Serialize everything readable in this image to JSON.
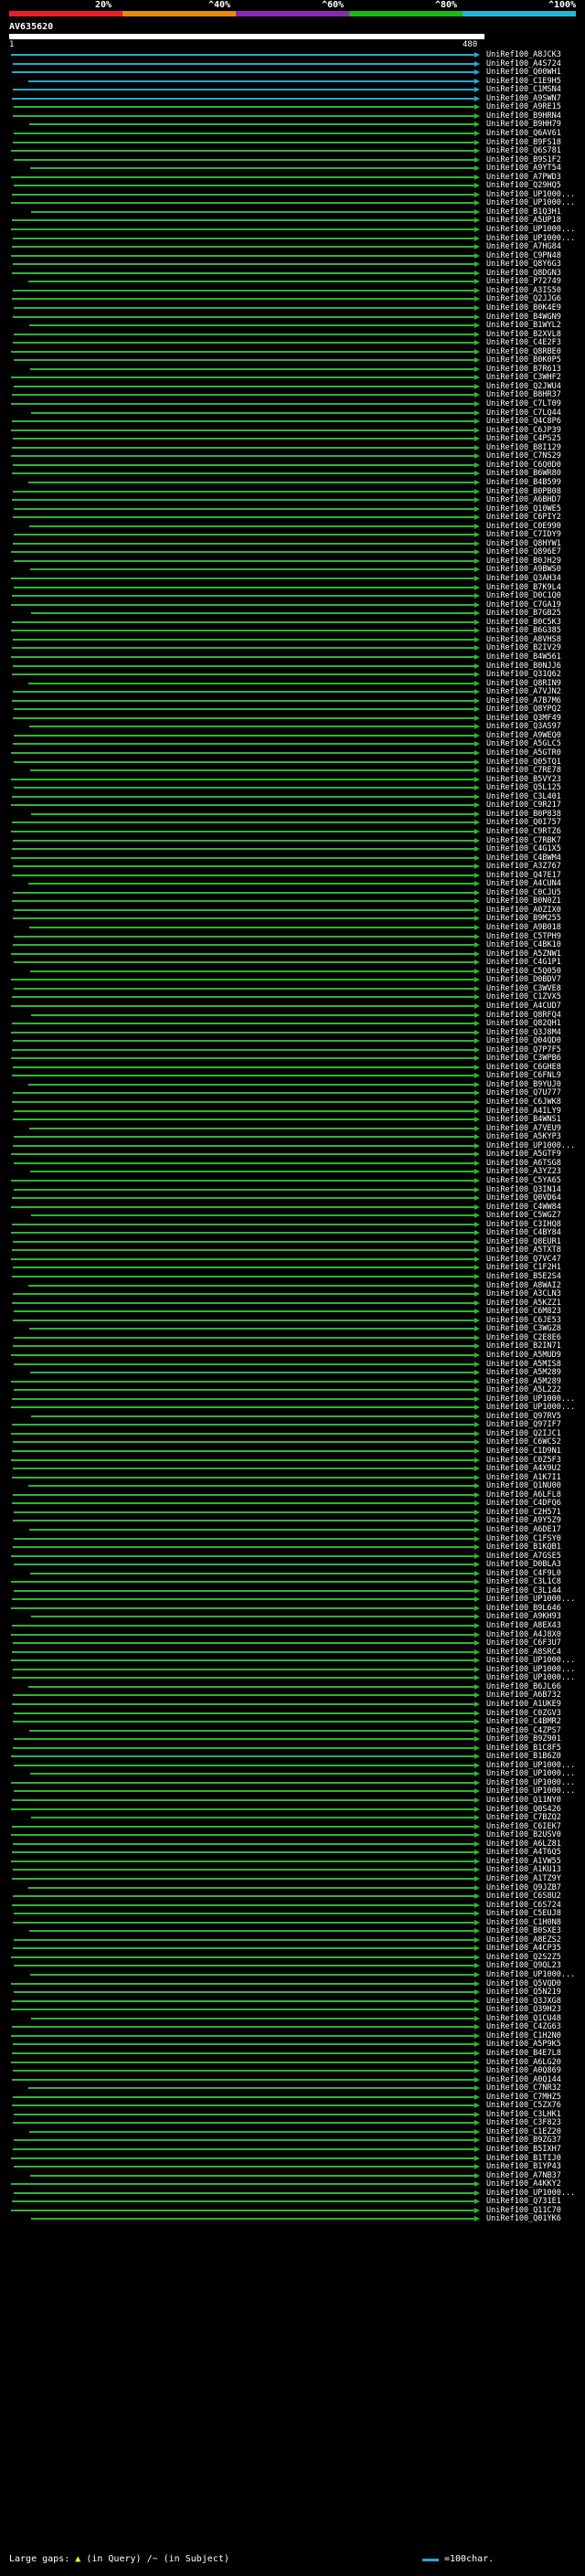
{
  "legend": {
    "labels": [
      "20%",
      "^40%",
      "^60%",
      "^80%",
      "^100%"
    ],
    "colors": [
      "#e8202a",
      "#e88a10",
      "#8a28b0",
      "#18b818",
      "#22b8d8"
    ]
  },
  "query": {
    "name": "AV635620",
    "start": "1",
    "end": "480"
  },
  "hits": [
    "UniRef100_A8JCK3",
    "UniRef100_A4S724",
    "UniRef100_Q00WH1",
    "UniRef100_C1E9H5",
    "UniRef100_C1MSN4",
    "UniRef100_A9SWN7",
    "UniRef100_A9RE15",
    "UniRef100_B9HRN4",
    "UniRef100_B9HH79",
    "UniRef100_Q6AV61",
    "UniRef100_B9FS18",
    "UniRef100_Q6S781",
    "UniRef100_B9S1F2",
    "UniRef100_A9YT54",
    "UniRef100_A7PWD3",
    "UniRef100_Q29HQ5",
    "UniRef100_UP1000...",
    "UniRef100_UP1000...",
    "UniRef100_B1Q3H1",
    "UniRef100_A5UP18",
    "UniRef100_UP1000...",
    "UniRef100_UP1000...",
    "UniRef100_A7HG84",
    "UniRef100_C9PN48",
    "UniRef100_Q8Y6G3",
    "UniRef100_Q8DGN3",
    "UniRef100_P72749",
    "UniRef100_A3IS50",
    "UniRef100_Q2JJG6",
    "UniRef100_B0K4E9",
    "UniRef100_B4WGN9",
    "UniRef100_B1WYL2",
    "UniRef100_B2XVL8",
    "UniRef100_C4E2F3",
    "UniRef100_Q8RBE0",
    "UniRef100_B0K0P5",
    "UniRef100_B7R613",
    "UniRef100_C3WHF2",
    "UniRef100_Q2JWU4",
    "UniRef100_B8HR37",
    "UniRef100_C7LT09",
    "UniRef100_C7LQ44",
    "UniRef100_Q4C8P6",
    "UniRef100_C6JP39",
    "UniRef100_C4PS25",
    "UniRef100_B8I129",
    "UniRef100_C7NS29",
    "UniRef100_C6Q0D0",
    "UniRef100_B6WR80",
    "UniRef100_B4B599",
    "UniRef100_B0PB08",
    "UniRef100_A6BHD7",
    "UniRef100_Q10WE5",
    "UniRef100_C6PIY2",
    "UniRef100_C0E990",
    "UniRef100_C7IDY9",
    "UniRef100_Q8HYW1",
    "UniRef100_Q896E7",
    "UniRef100_B0JH29",
    "UniRef100_A9BWS0",
    "UniRef100_Q3AH34",
    "UniRef100_B7K9L4",
    "UniRef100_D0C1Q0",
    "UniRef100_C7GA19",
    "UniRef100_B7GB25",
    "UniRef100_B0C5K3",
    "UniRef100_B6G385",
    "UniRef100_A8VHS8",
    "UniRef100_B2IV29",
    "UniRef100_B4W561",
    "UniRef100_B0NJJ6",
    "UniRef100_Q31Q62",
    "UniRef100_Q8RIN9",
    "UniRef100_A7VJN2",
    "UniRef100_A7B7M6",
    "UniRef100_Q8YPQ2",
    "UniRef100_Q3MF49",
    "UniRef100_Q3AS97",
    "UniRef100_A9WEQ0",
    "UniRef100_A5GLC5",
    "UniRef100_A5GTR0",
    "UniRef100_Q05TQ1",
    "UniRef100_C7RE78",
    "UniRef100_B5VY23",
    "UniRef100_Q5L125",
    "UniRef100_C3L401",
    "UniRef100_C9R217",
    "UniRef100_B0P838",
    "UniRef100_Q0I757",
    "UniRef100_C9RTZ6",
    "UniRef100_C7RBK7",
    "UniRef100_C4G1X5",
    "UniRef100_C4BWM4",
    "UniRef100_A3Z767",
    "UniRef100_Q47E17",
    "UniRef100_A4CUN4",
    "UniRef100_C0CJU5",
    "UniRef100_B0N0Z1",
    "UniRef100_A0ZIX0",
    "UniRef100_B9M255",
    "UniRef100_A9B018",
    "UniRef100_C5TPH9",
    "UniRef100_C4BK10",
    "UniRef100_A5ZNW1",
    "UniRef100_C4G1P1",
    "UniRef100_C5Q050",
    "UniRef100_D0BDV7",
    "UniRef100_C3WVE8",
    "UniRef100_C1ZVX5",
    "UniRef100_A4CUD7",
    "UniRef100_Q8RFQ4",
    "UniRef100_Q82QH1",
    "UniRef100_Q3J8M4",
    "UniRef100_Q04QD0",
    "UniRef100_Q7P7F5",
    "UniRef100_C3WPB6",
    "UniRef100_C6GHE8",
    "UniRef100_C6FNL9",
    "UniRef100_B9YUJ0",
    "UniRef100_Q7U777",
    "UniRef100_C6JWK8",
    "UniRef100_A4ILY9",
    "UniRef100_B4WNS1",
    "UniRef100_A7VEU9",
    "UniRef100_A5KYP3",
    "UniRef100_UP1000...",
    "UniRef100_A5GTF9",
    "UniRef100_A6TSG8",
    "UniRef100_A3YZ23",
    "UniRef100_C5YA65",
    "UniRef100_Q3IN14",
    "UniRef100_Q0VD64",
    "UniRef100_C4WW84",
    "UniRef100_C5WGZ7",
    "UniRef100_C3IHQ8",
    "UniRef100_C4BY84",
    "UniRef100_Q8EUR1",
    "UniRef100_A5TXT8",
    "UniRef100_Q7VC47",
    "UniRef100_C1F2H1",
    "UniRef100_B5E2S4",
    "UniRef100_A8WAI2",
    "UniRef100_A3CLN3",
    "UniRef100_A5KZZ1",
    "UniRef100_C6M823",
    "UniRef100_C6JE53",
    "UniRef100_C3WGZ8",
    "UniRef100_C2E8E6",
    "UniRef100_B2IN71",
    "UniRef100_A5MUD9",
    "UniRef100_A5MIS8",
    "UniRef100_A5M289",
    "UniRef100_A5M289",
    "UniRef100_A5L222",
    "UniRef100_UP1000...",
    "UniRef100_UP1000...",
    "UniRef100_Q97RV5",
    "UniRef100_Q97IF7",
    "UniRef100_Q2IJC1",
    "UniRef100_C6WCS2",
    "UniRef100_C1D9N1",
    "UniRef100_C0Z5F3",
    "UniRef100_A4X9U2",
    "UniRef100_A1K7I1",
    "UniRef100_Q1NU00",
    "UniRef100_A6LFL8",
    "UniRef100_C4DFQ6",
    "UniRef100_C2H571",
    "UniRef100_A9Y5Z9",
    "UniRef100_A6DE17",
    "UniRef100_C1FSY0",
    "UniRef100_B1KQB1",
    "UniRef100_A7GSE5",
    "UniRef100_D0BLA3",
    "UniRef100_C4F9L0",
    "UniRef100_C3L1C8",
    "UniRef100_C3L144",
    "UniRef100_UP1000...",
    "UniRef100_B9L646",
    "UniRef100_A9KH93",
    "UniRef100_A8EX43",
    "UniRef100_A4J8X0",
    "UniRef100_C6F3U7",
    "UniRef100_A8SRC4",
    "UniRef100_UP1000...",
    "UniRef100_UP1000...",
    "UniRef100_UP1000...",
    "UniRef100_B6JL66",
    "UniRef100_A6B732",
    "UniRef100_A1UKE9",
    "UniRef100_C0ZGV3",
    "UniRef100_C4BMR2",
    "UniRef100_C4ZPS7",
    "UniRef100_B9Z901",
    "UniRef100_B1C8F5",
    "UniRef100_B1B6Z0",
    "UniRef100_UP1000...",
    "UniRef100_UP1000...",
    "UniRef100_UP1000...",
    "UniRef100_UP1000...",
    "UniRef100_Q11NY0",
    "UniRef100_Q0S426",
    "UniRef100_C7BZQ2",
    "UniRef100_C6IEK7",
    "UniRef100_B2USV0",
    "UniRef100_A6LZ81",
    "UniRef100_A4T6Q5",
    "UniRef100_A1VW55",
    "UniRef100_A1KU13",
    "UniRef100_A1TZ9Y",
    "UniRef100_Q9JZB7",
    "UniRef100_C6S8U2",
    "UniRef100_C6S724",
    "UniRef100_C5EUJ8",
    "UniRef100_C1H0N8",
    "UniRef100_B0SXE3",
    "UniRef100_A8EZS2",
    "UniRef100_A4CP35",
    "UniRef100_Q2S2Z5",
    "UniRef100_Q9QL23",
    "UniRef100_UP1000...",
    "UniRef100_Q5VQD0",
    "UniRef100_Q5N219",
    "UniRef100_Q3JXG8",
    "UniRef100_Q39H23",
    "UniRef100_Q1CU48",
    "UniRef100_C4ZG63",
    "UniRef100_C1H2N0",
    "UniRef100_A5P9K5",
    "UniRef100_B4E7L8",
    "UniRef100_A6LG20",
    "UniRef100_A0Q869",
    "UniRef100_A0Q144",
    "UniRef100_C7NR32",
    "UniRef100_C7MHZ5",
    "UniRef100_C5ZX76",
    "UniRef100_C3LHK1",
    "UniRef100_C3F823",
    "UniRef100_C1EZ20",
    "UniRef100_B9ZG37",
    "UniRef100_B5IXH7",
    "UniRef100_B1TIJ0",
    "UniRef100_B1YP43",
    "UniRef100_A7NB37",
    "UniRef100_A4KKY2",
    "UniRef100_UP1000...",
    "UniRef100_Q731E1",
    "UniRef100_Q11C70",
    "UniRef100_Q01YK6"
  ],
  "footer": {
    "large_gaps_label": "Large gaps:",
    "large_gaps_query": "(in Query)",
    "large_gaps_subject": "/~ (in Subject)",
    "scale_label": "=100char."
  }
}
